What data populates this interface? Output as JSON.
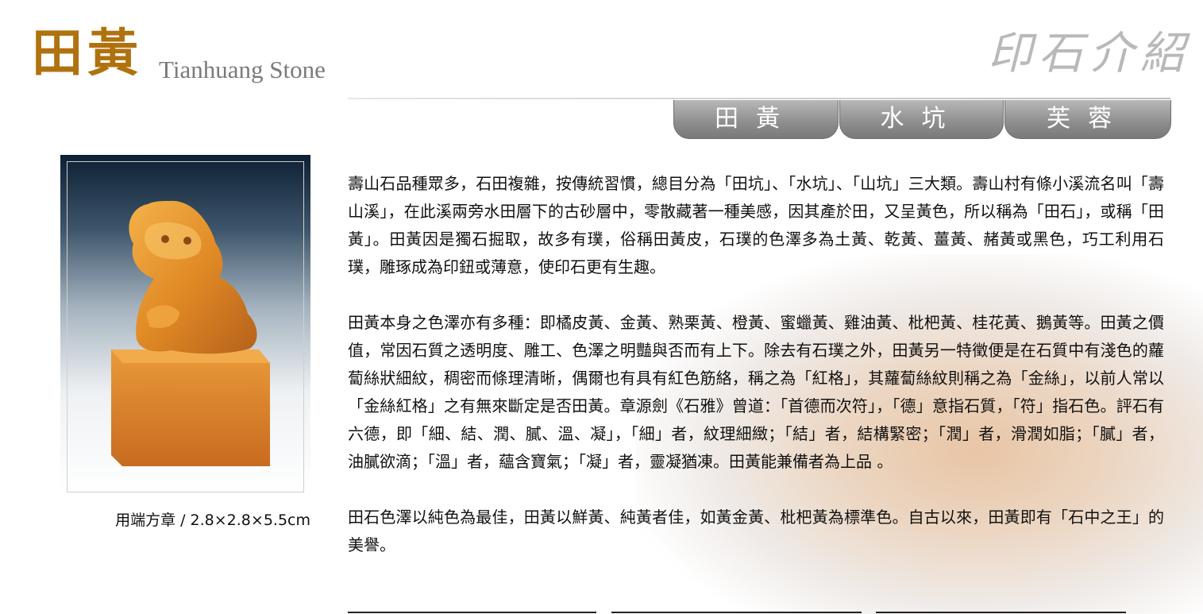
{
  "header": {
    "logo_cn": "田黃",
    "logo_en": "Tianhuang Stone",
    "brand_cn": "印石介紹"
  },
  "tabs": [
    {
      "label": "田黃"
    },
    {
      "label": "水坑"
    },
    {
      "label": "芙蓉"
    }
  ],
  "product": {
    "image_icon": "seal-stone-photo",
    "caption": "用端方章 / 2.8×2.8×5.5cm"
  },
  "content": {
    "p1": "壽山石品種眾多，石田複雜，按傳統習慣，總目分為「田坑」、「水坑」、「山坑」三大類。壽山村有條小溪流名叫「壽山溪」，在此溪兩旁水田層下的古砂層中，零散藏著一種美感，因其產於田，又呈黃色，所以稱為「田石」，或稱「田黃」。田黃因是獨石掘取，故多有璞，俗稱田黃皮，石璞的色澤多為土黃、乾黃、薑黃、赭黃或黑色，巧工利用石璞，雕琢成為印鈕或薄意，使印石更有生趣。",
    "p2": "田黃本身之色澤亦有多種：即橘皮黃、金黃、熟栗黃、橙黃、蜜蠟黃、雞油黃、枇杷黃、桂花黃、鵝黃等。田黃之價值，常因石質之透明度、雕工、色澤之明豔與否而有上下。除去有石璞之外，田黃另一特徵便是在石質中有淺色的蘿蔔絲狀細紋，稠密而條理清晰，偶爾也有具有紅色筋絡，稱之為「紅格」，其蘿蔔絲紋則稱之為「金絲」，以前人常以「金絲紅格」之有無來斷定是否田黃。章源劍《石雅》曾道：「首德而次符」，「德」意指石質，「符」指石色。評石有六德，即「細、結、潤、膩、溫、凝」，「細」者，紋理細緻；「結」者，結構緊密；「潤」者，滑潤如脂；「膩」者，油膩欲滴；「溫」者，蘊含寶氣；「凝」者，靈凝猶凍。田黃能兼備者為上品 。",
    "p3": "田石色澤以純色為最佳，田黃以鮮黃、純黃者佳，如黃金黃、枇杷黃為標準色。自古以來，田黃即有「石中之王」的美譽。"
  },
  "colors": {
    "logo": "#b0720f",
    "tab_bg": "#8d8d8d",
    "tab_text": "#ffffff"
  }
}
